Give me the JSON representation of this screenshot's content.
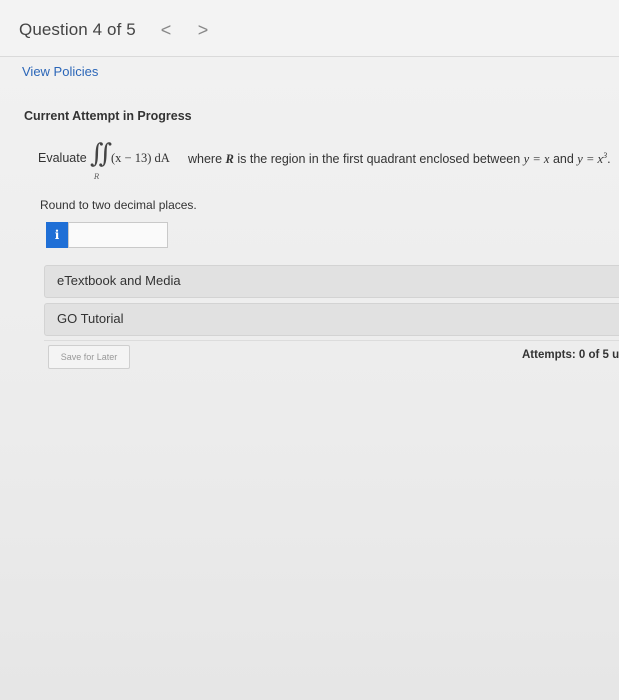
{
  "header": {
    "question_label": "Question 4 of 5",
    "prev_glyph": "<",
    "next_glyph": ">"
  },
  "links": {
    "view_policies": "View Policies"
  },
  "attempt_heading": "Current Attempt in Progress",
  "question": {
    "evaluate": "Evaluate",
    "integral_symbol": "∬",
    "region_subscript": "R",
    "integrand": "(x − 13) dA",
    "where": "where",
    "R": "R",
    "region_text": "is the region in the first quadrant enclosed between",
    "eq1": "y = x",
    "and": "and",
    "eq2_base": "y = x",
    "eq2_exp": "3",
    "period": "."
  },
  "instruction": "Round to two decimal places.",
  "answer": {
    "info_icon": "i",
    "value": ""
  },
  "resources": {
    "etextbook": "eTextbook and Media",
    "go_tutorial": "GO Tutorial"
  },
  "footer": {
    "save_for_later": "Save for Later",
    "attempts": "Attempts: 0 of 5 us"
  },
  "colors": {
    "link": "#2b66b8",
    "info_badge": "#1f6fd6"
  }
}
